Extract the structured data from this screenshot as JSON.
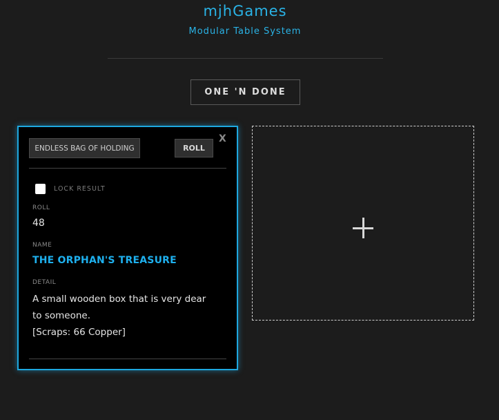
{
  "brand": {
    "title": "mjhGames",
    "subtitle": "Modular Table System"
  },
  "mode": {
    "label": "ONE 'N DONE"
  },
  "card": {
    "table_name": "ENDLESS BAG OF HOLDING",
    "roll_button": "ROLL",
    "close_label": "X",
    "lock_label": "LOCK RESULT",
    "lock_checked": false,
    "roll_label": "ROLL",
    "roll_value": "48",
    "name_label": "NAME",
    "name_value": "THE ORPHAN'S TREASURE",
    "detail_label": "DETAIL",
    "detail_lines": [
      "A small wooden box that is very dear",
      "to someone.",
      "[Scraps: 66 Copper]"
    ]
  },
  "add_slot": {
    "icon": "plus-icon"
  },
  "colors": {
    "background": "#1c1c1c",
    "accent": "#1ea8e0",
    "card_background": "#000000"
  }
}
